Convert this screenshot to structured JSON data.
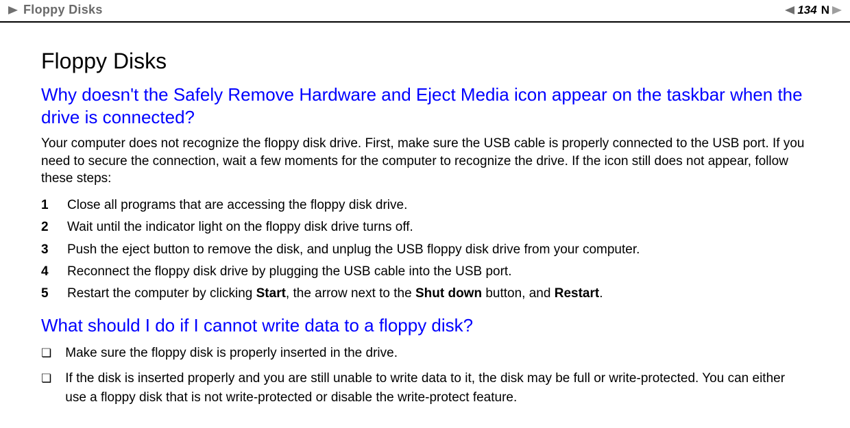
{
  "header": {
    "breadcrumb": "Floppy Disks",
    "page_number": "134",
    "nav_letter": "N"
  },
  "section": {
    "title": "Floppy Disks"
  },
  "q1": {
    "heading": "Why doesn't the Safely Remove Hardware and Eject Media icon appear on the taskbar when the drive is connected?",
    "intro": "Your computer does not recognize the floppy disk drive. First, make sure the USB cable is properly connected to the USB port. If you need to secure the connection, wait a few moments for the computer to recognize the drive. If the icon still does not appear, follow these steps:",
    "steps": [
      {
        "n": "1",
        "t": "Close all programs that are accessing the floppy disk drive."
      },
      {
        "n": "2",
        "t": "Wait until the indicator light on the floppy disk drive turns off."
      },
      {
        "n": "3",
        "t": "Push the eject button to remove the disk, and unplug the USB floppy disk drive from your computer."
      },
      {
        "n": "4",
        "t": "Reconnect the floppy disk drive by plugging the USB cable into the USB port."
      }
    ],
    "step5": {
      "n": "5",
      "pre": "Restart the computer by clicking ",
      "b1": "Start",
      "mid1": ", the arrow next to the ",
      "b2": "Shut down",
      "mid2": " button, and ",
      "b3": "Restart",
      "post": "."
    }
  },
  "q2": {
    "heading": "What should I do if I cannot write data to a floppy disk?",
    "bullets": [
      "Make sure the floppy disk is properly inserted in the drive.",
      "If the disk is inserted properly and you are still unable to write data to it, the disk may be full or write-protected. You can either use a floppy disk that is not write-protected or disable the write-protect feature."
    ]
  }
}
